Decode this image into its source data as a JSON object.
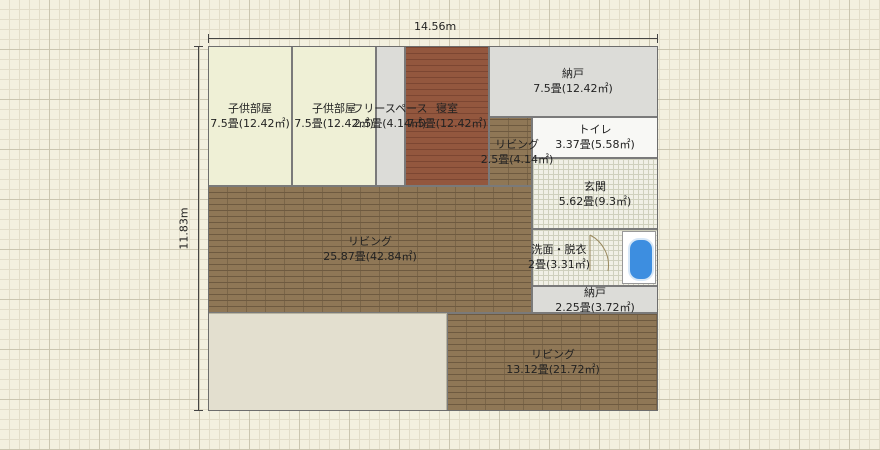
{
  "dimensions": {
    "width_label": "14.56m",
    "height_label": "11.83m"
  },
  "rooms": [
    {
      "name": "子供部屋",
      "area": "7.5畳(12.42㎡)"
    },
    {
      "name": "子供部屋",
      "area": "7.5畳(12.42㎡)"
    },
    {
      "name": "フリースペース",
      "area": "2.5畳(4.14㎡)"
    },
    {
      "name": "寝室",
      "area": "7.5畳(12.42㎡)"
    },
    {
      "name": "納戸",
      "area": "7.5畳(12.42㎡)"
    },
    {
      "name": "トイレ",
      "area": "3.37畳(5.58㎡)"
    },
    {
      "name": "リビング",
      "area": "2.5畳(4.14㎡)"
    },
    {
      "name": "玄関",
      "area": "5.62畳(9.3㎡)"
    },
    {
      "name": "リビング",
      "area": "25.87畳(42.84㎡)"
    },
    {
      "name": "洗面・脱衣",
      "area": "2畳(3.31㎡)"
    },
    {
      "name": "納戸",
      "area": "2.25畳(3.72㎡)"
    },
    {
      "name": "リビング",
      "area": "13.12畳(21.72㎡)"
    }
  ],
  "colors": {
    "wood": "#8f7756",
    "bedroom_wood": "#93573e",
    "tatami": "#eff0d6",
    "storage_gray": "#dcdcd8",
    "bath_blue": "#3d8ee0"
  },
  "fixtures": [
    "bathtub-icon",
    "door-swing-icon"
  ]
}
